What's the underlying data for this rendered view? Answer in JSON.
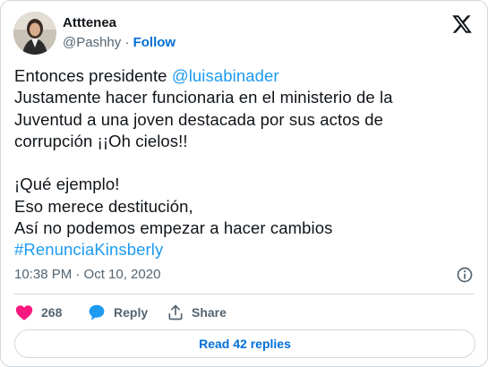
{
  "author": {
    "name": "Atttenea",
    "handle": "@Pashhy",
    "separator": "·",
    "follow_label": "Follow"
  },
  "tweet": {
    "lines": [
      {
        "text": "Entonces presidente ",
        "mention": "@luisabinader"
      },
      {
        "text": "Justamente hacer funcionaria en el ministerio de la"
      },
      {
        "text": "Juventud a una joven destacada por sus actos de"
      },
      {
        "text": "corrupción ¡¡Oh cielos!!"
      },
      {
        "text": "¡Qué ejemplo!"
      },
      {
        "text": "Eso merece destitución,"
      },
      {
        "text": "Así no podemos empezar a hacer cambios"
      },
      {
        "hashtag": "#RenunciaKinsberly"
      }
    ]
  },
  "timestamp": "10:38 PM · Oct 10, 2020",
  "actions": {
    "like_count": "268",
    "reply_label": "Reply",
    "share_label": "Share"
  },
  "read_replies_label": "Read 42 replies",
  "colors": {
    "like": "#f91880",
    "reply": "#1d9bf0",
    "link": "#1d9bf0",
    "follow": "#006fd6",
    "secondary_text": "#536471",
    "border": "#cfd9de"
  },
  "icons": [
    "x-logo-icon",
    "info-icon",
    "heart-icon",
    "reply-bubble-icon",
    "share-icon"
  ]
}
